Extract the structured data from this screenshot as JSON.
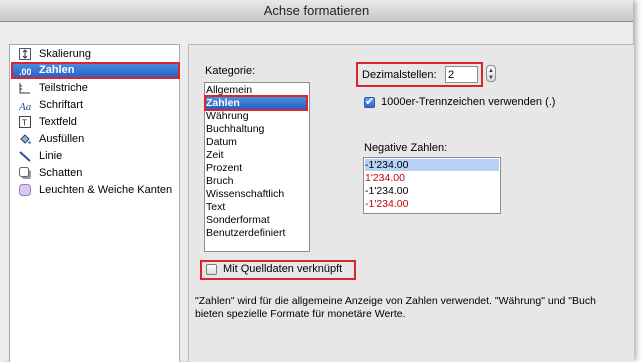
{
  "window": {
    "title": "Achse formatieren"
  },
  "sidebar": {
    "items": [
      {
        "label": "Skalierung",
        "icon": "scaling-icon"
      },
      {
        "label": "Zahlen",
        "icon": "number-format-icon"
      },
      {
        "label": "Teilstriche",
        "icon": "tick-marks-icon"
      },
      {
        "label": "Schriftart",
        "icon": "font-icon"
      },
      {
        "label": "Textfeld",
        "icon": "text-box-icon"
      },
      {
        "label": "Ausfüllen",
        "icon": "fill-bucket-icon"
      },
      {
        "label": "Linie",
        "icon": "line-icon"
      },
      {
        "label": "Schatten",
        "icon": "shadow-icon"
      },
      {
        "label": "Leuchten & Weiche Kanten",
        "icon": "glow-icon"
      }
    ],
    "selected": "Zahlen"
  },
  "number": {
    "category_label": "Kategorie:",
    "categories": [
      "Allgemein",
      "Zahlen",
      "Währung",
      "Buchhaltung",
      "Datum",
      "Zeit",
      "Prozent",
      "Bruch",
      "Wissenschaftlich",
      "Text",
      "Sonderformat",
      "Benutzerdefiniert"
    ],
    "selected_category": "Zahlen",
    "decimals_label": "Dezimalstellen:",
    "decimals_value": "2",
    "thousands_label": "1000er-Trennzeichen verwenden (.)",
    "thousands_checked": true,
    "negative_label": "Negative Zahlen:",
    "negative_options": [
      {
        "text": "-1'234.00",
        "color": "#000000"
      },
      {
        "text": "1'234.00",
        "color": "#cc0000"
      },
      {
        "text": "-1'234.00",
        "color": "#000000"
      },
      {
        "text": "-1'234.00",
        "color": "#cc0000"
      }
    ],
    "linked_label": "Mit Quelldaten verknüpft",
    "linked_checked": false,
    "description_line1": "\"Zahlen\" wird für die allgemeine Anzeige von Zahlen verwendet. \"Währung\" und \"Buch",
    "description_line2": "bieten spezielle Formate für monetäre Werte."
  },
  "colors": {
    "highlight": "#2f6fd6",
    "annotation": "#d9262b",
    "negative_red": "#cc0000"
  }
}
